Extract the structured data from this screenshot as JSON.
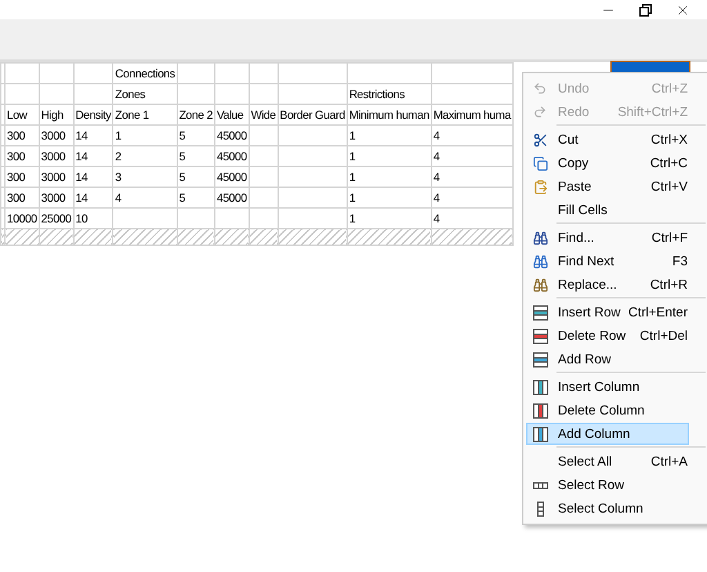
{
  "table": {
    "columns": [
      {
        "name": "Low"
      },
      {
        "name": "High"
      },
      {
        "name": "Density"
      },
      {
        "name": "Zone 1",
        "group": "Connections",
        "subgroup": "Zones"
      },
      {
        "name": "Zone 2"
      },
      {
        "name": "Value"
      },
      {
        "name": "Wide"
      },
      {
        "name": "Border Guard"
      },
      {
        "name": "Minimum human",
        "subgroup": "Restrictions"
      },
      {
        "name": "Maximum huma"
      }
    ],
    "rows": [
      {
        "cells": [
          "300",
          "3000",
          "14",
          "1",
          "5",
          "45000",
          null,
          null,
          "1",
          "4"
        ]
      },
      {
        "cells": [
          "300",
          "3000",
          "14",
          "2",
          "5",
          "45000",
          null,
          null,
          "1",
          "4"
        ]
      },
      {
        "cells": [
          "300",
          "3000",
          "14",
          "3",
          "5",
          "45000",
          null,
          null,
          "1",
          "4"
        ]
      },
      {
        "cells": [
          "300",
          "3000",
          "14",
          "4",
          "5",
          "45000",
          null,
          null,
          "1",
          "4"
        ]
      },
      {
        "cells": [
          "10000",
          "25000",
          "10",
          null,
          null,
          null,
          null,
          null,
          "1",
          "4"
        ]
      }
    ]
  },
  "context_menu": {
    "groups": [
      [
        {
          "label": "Undo",
          "shortcut": "Ctrl+Z",
          "disabled": true,
          "selected": false
        },
        {
          "label": "Redo",
          "shortcut": "Shift+Ctrl+Z",
          "disabled": true,
          "selected": false
        }
      ],
      [
        {
          "label": "Cut",
          "shortcut": "Ctrl+X",
          "disabled": false,
          "selected": false
        },
        {
          "label": "Copy",
          "shortcut": "Ctrl+C",
          "disabled": false,
          "selected": false
        },
        {
          "label": "Paste",
          "shortcut": "Ctrl+V",
          "disabled": false,
          "selected": false
        },
        {
          "label": "Fill Cells",
          "disabled": false,
          "selected": false
        }
      ],
      [
        {
          "label": "Find...",
          "shortcut": "Ctrl+F",
          "disabled": false,
          "selected": false
        },
        {
          "label": "Find Next",
          "shortcut": "F3",
          "disabled": false,
          "selected": false
        },
        {
          "label": "Replace...",
          "shortcut": "Ctrl+R",
          "disabled": false,
          "selected": false
        }
      ],
      [
        {
          "label": "Insert Row",
          "shortcut": "Ctrl+Enter",
          "disabled": false,
          "selected": false
        },
        {
          "label": "Delete Row",
          "shortcut": "Ctrl+Del",
          "disabled": false,
          "selected": false
        },
        {
          "label": "Add Row",
          "disabled": false,
          "selected": false
        }
      ],
      [
        {
          "label": "Insert Column",
          "disabled": false,
          "selected": false
        },
        {
          "label": "Delete Column",
          "disabled": false,
          "selected": false
        },
        {
          "label": "Add Column",
          "disabled": false,
          "selected": true
        }
      ],
      [
        {
          "label": "Select All",
          "shortcut": "Ctrl+A",
          "disabled": false,
          "selected": false
        },
        {
          "label": "Select Row",
          "disabled": false,
          "selected": false
        },
        {
          "label": "Select Column",
          "disabled": false,
          "selected": false
        }
      ]
    ]
  }
}
